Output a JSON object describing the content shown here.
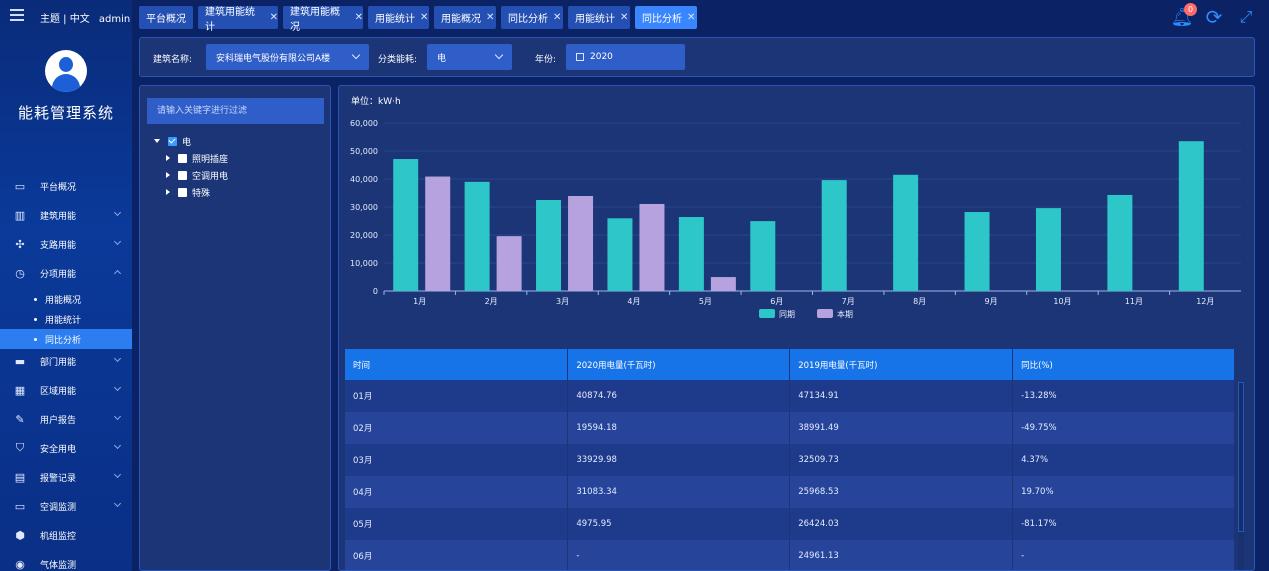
{
  "sidebar": {
    "top_links": "主题 | 中文",
    "user": "admin",
    "system_title": "能耗管理系统",
    "items": [
      {
        "label": "平台概况",
        "icon": "monitor-icon",
        "expandable": false
      },
      {
        "label": "建筑用能",
        "icon": "building-icon",
        "expandable": true
      },
      {
        "label": "支路用能",
        "icon": "branch-network-icon",
        "expandable": true
      },
      {
        "label": "分项用能",
        "icon": "gauge-icon",
        "expandable": true,
        "expanded": true
      },
      {
        "label": "部门用能",
        "icon": "folder-icon",
        "expandable": true
      },
      {
        "label": "区域用能",
        "icon": "region-building-icon",
        "expandable": true
      },
      {
        "label": "用户报告",
        "icon": "edit-report-icon",
        "expandable": true
      },
      {
        "label": "安全用电",
        "icon": "shield-check-icon",
        "expandable": true
      },
      {
        "label": "报警记录",
        "icon": "alarm-document-icon",
        "expandable": true
      },
      {
        "label": "空调监测",
        "icon": "air-conditioner-icon",
        "expandable": true
      },
      {
        "label": "机组监控",
        "icon": "hexagon-icon",
        "expandable": false
      },
      {
        "label": "气体监测",
        "icon": "gas-icon",
        "expandable": false
      }
    ],
    "subitems": [
      {
        "label": "用能概况",
        "active": false
      },
      {
        "label": "用能统计",
        "active": false
      },
      {
        "label": "同比分析",
        "active": true
      }
    ]
  },
  "tabs": [
    {
      "label": "平台概况",
      "closable": false,
      "active": false
    },
    {
      "label": "建筑用能统计",
      "closable": true,
      "active": false
    },
    {
      "label": "建筑用能概况",
      "closable": true,
      "active": false
    },
    {
      "label": "用能统计",
      "closable": true,
      "active": false
    },
    {
      "label": "用能概况",
      "closable": true,
      "active": false
    },
    {
      "label": "同比分析",
      "closable": true,
      "active": false
    },
    {
      "label": "用能统计",
      "closable": true,
      "active": false
    },
    {
      "label": "同比分析",
      "closable": true,
      "active": true
    }
  ],
  "header_icons": {
    "notification_count": "0",
    "icons": [
      "bell-icon",
      "refresh-icon",
      "fullscreen-icon"
    ]
  },
  "filters": {
    "building_label": "建筑名称:",
    "building_value": "安科瑞电气股份有限公司A楼",
    "category_label": "分类能耗:",
    "category_value": "电",
    "year_label": "年份:",
    "year_value": "2020"
  },
  "tree": {
    "search_placeholder": "请输入关键字进行过滤",
    "root": {
      "label": "电",
      "checked": true,
      "expanded": true
    },
    "children": [
      {
        "label": "照明插座",
        "checked": false
      },
      {
        "label": "空调用电",
        "checked": false
      },
      {
        "label": "特殊",
        "checked": false
      }
    ]
  },
  "chart_unit": "单位：kW·h",
  "chart_data": {
    "type": "bar",
    "categories": [
      "1月",
      "2月",
      "3月",
      "4月",
      "5月",
      "6月",
      "7月",
      "8月",
      "9月",
      "10月",
      "11月",
      "12月"
    ],
    "series": [
      {
        "name": "同期",
        "color": "#2ec7c9",
        "values": [
          47134.91,
          38991.49,
          32509.73,
          25968.53,
          26424.03,
          24961.13,
          39600,
          41500,
          28200,
          29600,
          34300,
          53500
        ]
      },
      {
        "name": "本期",
        "color": "#b6a2de",
        "values": [
          40874.76,
          19594.18,
          33929.98,
          31083.34,
          4975.95,
          null,
          null,
          null,
          null,
          null,
          null,
          null
        ]
      }
    ],
    "ylim": [
      0,
      60000
    ],
    "yticks": [
      "0",
      "10,000",
      "20,000",
      "30,000",
      "40,000",
      "50,000",
      "60,000"
    ],
    "grid": true,
    "legend_position": "bottom-center"
  },
  "table": {
    "headers": [
      "时间",
      "2020用电量(千瓦时)",
      "2019用电量(千瓦时)",
      "同比(%)"
    ],
    "rows": [
      [
        "01月",
        "40874.76",
        "47134.91",
        "-13.28%"
      ],
      [
        "02月",
        "19594.18",
        "38991.49",
        "-49.75%"
      ],
      [
        "03月",
        "33929.98",
        "32509.73",
        "4.37%"
      ],
      [
        "04月",
        "31083.34",
        "25968.53",
        "19.70%"
      ],
      [
        "05月",
        "4975.95",
        "26424.03",
        "-81.17%"
      ],
      [
        "06月",
        "-",
        "24961.13",
        "-"
      ]
    ]
  }
}
